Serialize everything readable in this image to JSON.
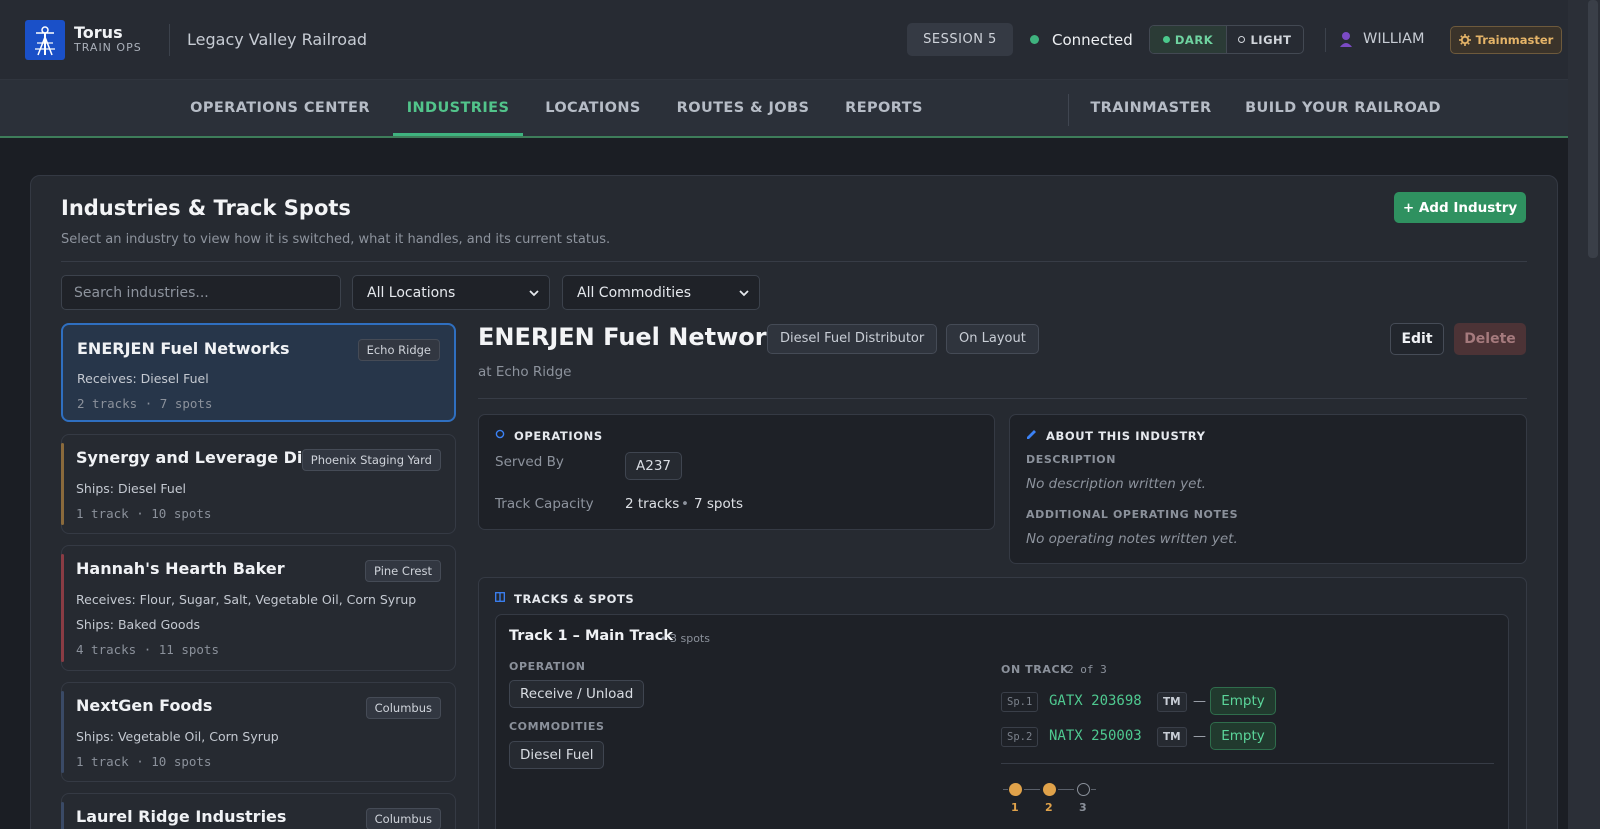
{
  "header": {
    "brand_name": "Torus",
    "brand_sub": "TRAIN OPS",
    "railroad": "Legacy Valley Railroad",
    "session": "SESSION 5",
    "connection": "Connected",
    "theme": {
      "dark": "DARK",
      "light": "LIGHT",
      "selected": "DARK"
    },
    "user": "WILLIAM",
    "role": "Trainmaster",
    "colors": {
      "accent_green": "#3fb37f",
      "role_gold": "#e5b468",
      "logo_blue": "#1a50c8"
    }
  },
  "nav": {
    "items": [
      "OPERATIONS CENTER",
      "INDUSTRIES",
      "LOCATIONS",
      "ROUTES & JOBS",
      "REPORTS"
    ],
    "right_items": [
      "TRAINMASTER",
      "BUILD YOUR RAILROAD"
    ],
    "active": "INDUSTRIES"
  },
  "page": {
    "title": "Industries & Track Spots",
    "subtitle": "Select an industry to view how it is switched, what it handles, and its current status.",
    "add_button": "+ Add Industry",
    "search_placeholder": "Search industries...",
    "location_filter": "All Locations",
    "commodity_filter": "All Commodities"
  },
  "industries": [
    {
      "name": "ENERJEN Fuel Networks",
      "location": "Echo Ridge",
      "lines": [
        "Receives: Diesel Fuel"
      ],
      "meta": "2 tracks · 7 spots",
      "selected": true,
      "accent": "#2f6fc0"
    },
    {
      "name": "Synergy and Leverage Dist",
      "location": "Phoenix Staging Yard",
      "lines": [
        "Ships: Diesel Fuel"
      ],
      "meta": "1 track · 10 spots",
      "accent": "#8a6a3c"
    },
    {
      "name": "Hannah's Hearth Baker",
      "location": "Pine Crest",
      "lines": [
        "Receives: Flour, Sugar, Salt, Vegetable Oil, Corn Syrup",
        "Ships: Baked Goods"
      ],
      "meta": "4 tracks · 11 spots",
      "accent": "#8a3c44"
    },
    {
      "name": "NextGen Foods",
      "location": "Columbus",
      "lines": [
        "Ships: Vegetable Oil, Corn Syrup"
      ],
      "meta": "1 track · 10 spots",
      "accent": "#3a4a66"
    },
    {
      "name": "Laurel Ridge Industries",
      "location": "Columbus",
      "lines": [],
      "meta": "",
      "accent": "#3a4a66"
    }
  ],
  "detail": {
    "name": "ENERJEN Fuel Networks",
    "type_tag": "Diesel Fuel Distributor",
    "status_tag": "On Layout",
    "location_line": "at Echo Ridge",
    "edit": "Edit",
    "delete": "Delete",
    "operations": {
      "heading": "OPERATIONS",
      "served_by_label": "Served By",
      "served_by": "A237",
      "capacity_label": "Track Capacity",
      "capacity_tracks": "2 tracks",
      "capacity_spots": "7 spots"
    },
    "about": {
      "heading": "ABOUT THIS INDUSTRY",
      "description_label": "DESCRIPTION",
      "description": "No description written yet.",
      "notes_label": "ADDITIONAL OPERATING NOTES",
      "notes": "No operating notes written yet."
    },
    "tracks": {
      "heading": "TRACKS & SPOTS",
      "track": {
        "name": "Track 1 – Main Track",
        "spots_count": "• 3 spots",
        "operation_label": "OPERATION",
        "operation": "Receive / Unload",
        "commodities_label": "COMMODITIES",
        "commodity": "Diesel Fuel",
        "on_track_label": "ON TRACK",
        "on_track_count": "2 of 3",
        "cars": [
          {
            "spot": "Sp.1",
            "car": "GATX 203698",
            "badge": "TM",
            "sep": "—",
            "status": "Empty"
          },
          {
            "spot": "Sp.2",
            "car": "NATX 250003",
            "badge": "TM",
            "sep": "—",
            "status": "Empty"
          }
        ],
        "progress": {
          "labels": [
            "1",
            "2",
            "3"
          ],
          "filled": 2,
          "total": 3
        }
      }
    }
  }
}
